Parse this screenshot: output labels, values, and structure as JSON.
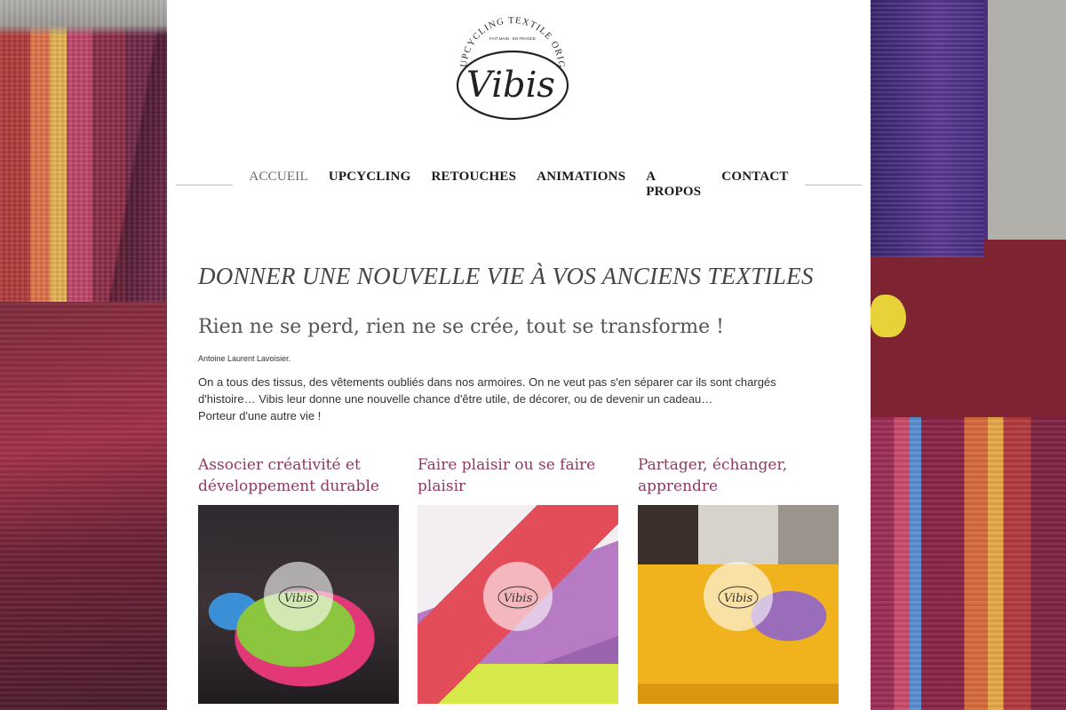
{
  "logo": {
    "arc_text": "UPCYCLING TEXTILE ORIGINAL",
    "small_text": "FAIT MAIN · EN FRANCE",
    "brand": "Vibis"
  },
  "nav": {
    "items": [
      {
        "label": "ACCUEIL",
        "active": true
      },
      {
        "label": "UPCYCLING",
        "active": false
      },
      {
        "label": "RETOUCHES",
        "active": false
      },
      {
        "label": "ANIMATIONS",
        "active": false
      },
      {
        "label": "A PROPOS",
        "active": false
      },
      {
        "label": "CONTACT",
        "active": false
      }
    ]
  },
  "hero": {
    "title": "DONNER UNE NOUVELLE VIE À VOS ANCIENS TEXTILES",
    "quote": "Rien ne se perd, rien ne se crée, tout se transforme !",
    "author": "Antoine Laurent Lavoisier.",
    "intro_line1": "On a tous des tissus, des vêtements oubliés dans nos armoires. On ne veut pas s'en séparer car ils sont chargés d'histoire… Vibis leur donne une nouvelle chance d'être utile, de décorer, ou de devenir un cadeau…",
    "intro_line2": "Porteur d'une autre vie !"
  },
  "cards": [
    {
      "title": "Associer créativité et développement durable",
      "badge": "Vibis",
      "image_icon": "sewing-machine-photo"
    },
    {
      "title": "Faire plaisir ou se faire plaisir",
      "badge": "Vibis",
      "image_icon": "gift-boxes-photo"
    },
    {
      "title": "Partager, échanger, apprendre",
      "badge": "Vibis",
      "image_icon": "sewing-workshop-photo"
    }
  ],
  "colors": {
    "accent": "#8d3a64",
    "text": "#333333",
    "nav_active": "#6b6b6b"
  }
}
